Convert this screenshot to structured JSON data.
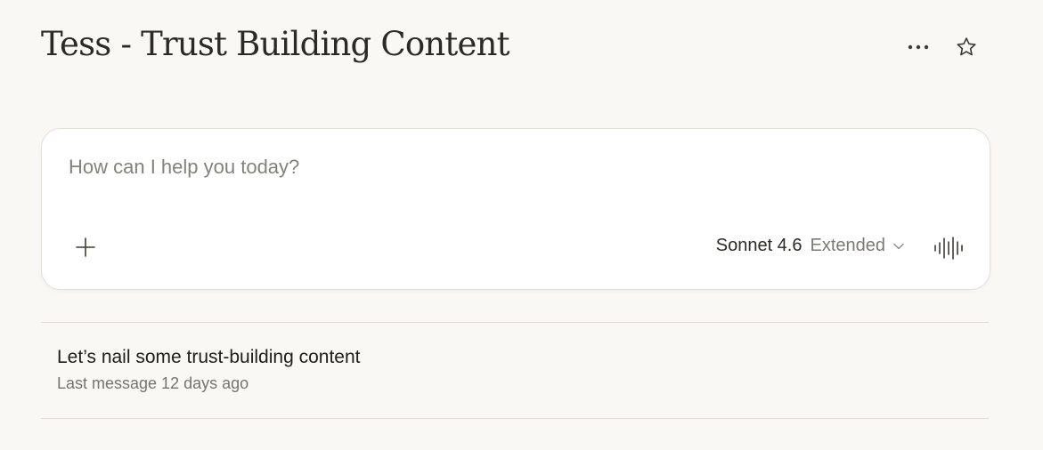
{
  "project": {
    "title": "Tess - Trust Building Content"
  },
  "header": {
    "more_icon": "ellipsis-horizontal",
    "star_icon": "star-outline"
  },
  "composer": {
    "placeholder": "How can I help you today?",
    "value": "",
    "add_icon": "plus",
    "model": "Sonnet 4.6",
    "mode": "Extended",
    "dropdown_icon": "chevron-down",
    "voice_icon": "audio-waveform"
  },
  "conversations": [
    {
      "title": "Let’s nail some trust-building content",
      "meta": "Last message 12 days ago"
    }
  ],
  "colors": {
    "background": "#f9f8f4",
    "card": "#ffffff",
    "text": "#1f1e1b",
    "muted": "#76746e"
  }
}
